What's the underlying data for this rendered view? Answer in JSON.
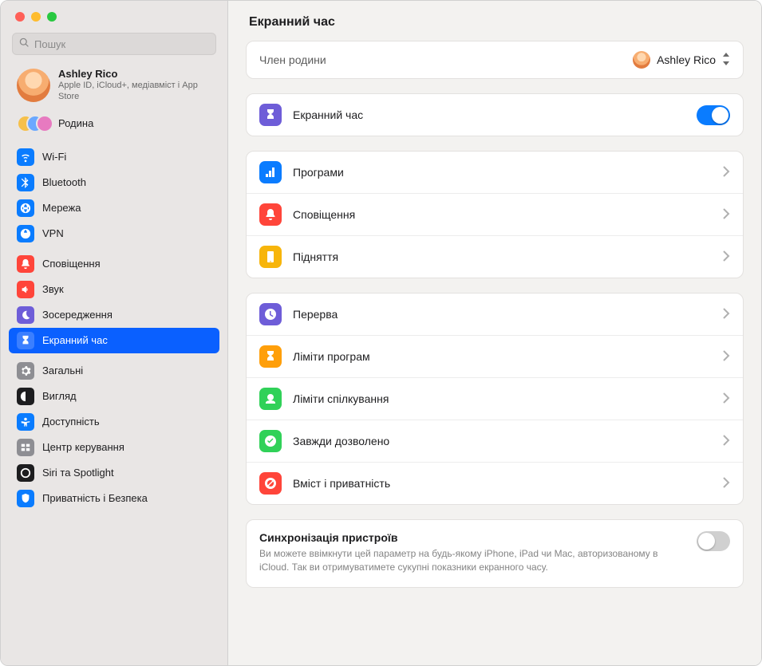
{
  "header": {
    "title": "Екранний час"
  },
  "search": {
    "placeholder": "Пошук"
  },
  "account": {
    "name": "Ashley Rico",
    "sub": "Apple ID, iCloud+, медіавміст і App Store"
  },
  "family": {
    "label": "Родина"
  },
  "sidebar": {
    "groups": [
      [
        {
          "id": "wifi",
          "label": "Wi-Fi",
          "color": "#0a7cff"
        },
        {
          "id": "bluetooth",
          "label": "Bluetooth",
          "color": "#0a7cff"
        },
        {
          "id": "network",
          "label": "Мережа",
          "color": "#0a7cff"
        },
        {
          "id": "vpn",
          "label": "VPN",
          "color": "#0a7cff"
        }
      ],
      [
        {
          "id": "notifications",
          "label": "Сповіщення",
          "color": "#ff453a"
        },
        {
          "id": "sound",
          "label": "Звук",
          "color": "#ff453a"
        },
        {
          "id": "focus",
          "label": "Зосередження",
          "color": "#6e5dd8"
        },
        {
          "id": "screentime",
          "label": "Екранний час",
          "color": "#6e5dd8",
          "selected": true
        }
      ],
      [
        {
          "id": "general",
          "label": "Загальні",
          "color": "#8e8e93"
        },
        {
          "id": "appearance",
          "label": "Вигляд",
          "color": "#1d1d1f"
        },
        {
          "id": "accessibility",
          "label": "Доступність",
          "color": "#0a7cff"
        },
        {
          "id": "controlcenter",
          "label": "Центр керування",
          "color": "#8e8e93"
        },
        {
          "id": "siri",
          "label": "Siri та Spotlight",
          "color": "#1d1d1f"
        },
        {
          "id": "privacy",
          "label": "Приватність і Безпека",
          "color": "#0a7cff"
        }
      ]
    ]
  },
  "main": {
    "member": {
      "label": "Член родини",
      "value": "Ashley Rico"
    },
    "screentime": {
      "label": "Екранний час",
      "on": true
    },
    "group1": [
      {
        "id": "apps",
        "label": "Програми",
        "color": "#0a7cff"
      },
      {
        "id": "notif",
        "label": "Сповіщення",
        "color": "#ff453a"
      },
      {
        "id": "pickups",
        "label": "Підняття",
        "color": "#f7b50b"
      }
    ],
    "group2": [
      {
        "id": "downtime",
        "label": "Перерва",
        "color": "#6e5dd8"
      },
      {
        "id": "applimits",
        "label": "Ліміти програм",
        "color": "#ff9f0a"
      },
      {
        "id": "commlimits",
        "label": "Ліміти спілкування",
        "color": "#30d158"
      },
      {
        "id": "allowed",
        "label": "Завжди дозволено",
        "color": "#30d158"
      },
      {
        "id": "content",
        "label": "Вміст і приватність",
        "color": "#ff453a"
      }
    ],
    "sync": {
      "title": "Синхронізація пристроїв",
      "desc": "Ви можете ввімкнути цей параметр на будь-якому iPhone, iPad чи Mac, авторизованому в iCloud. Так ви отримуватимете сукупні показники екранного часу.",
      "on": false
    }
  }
}
